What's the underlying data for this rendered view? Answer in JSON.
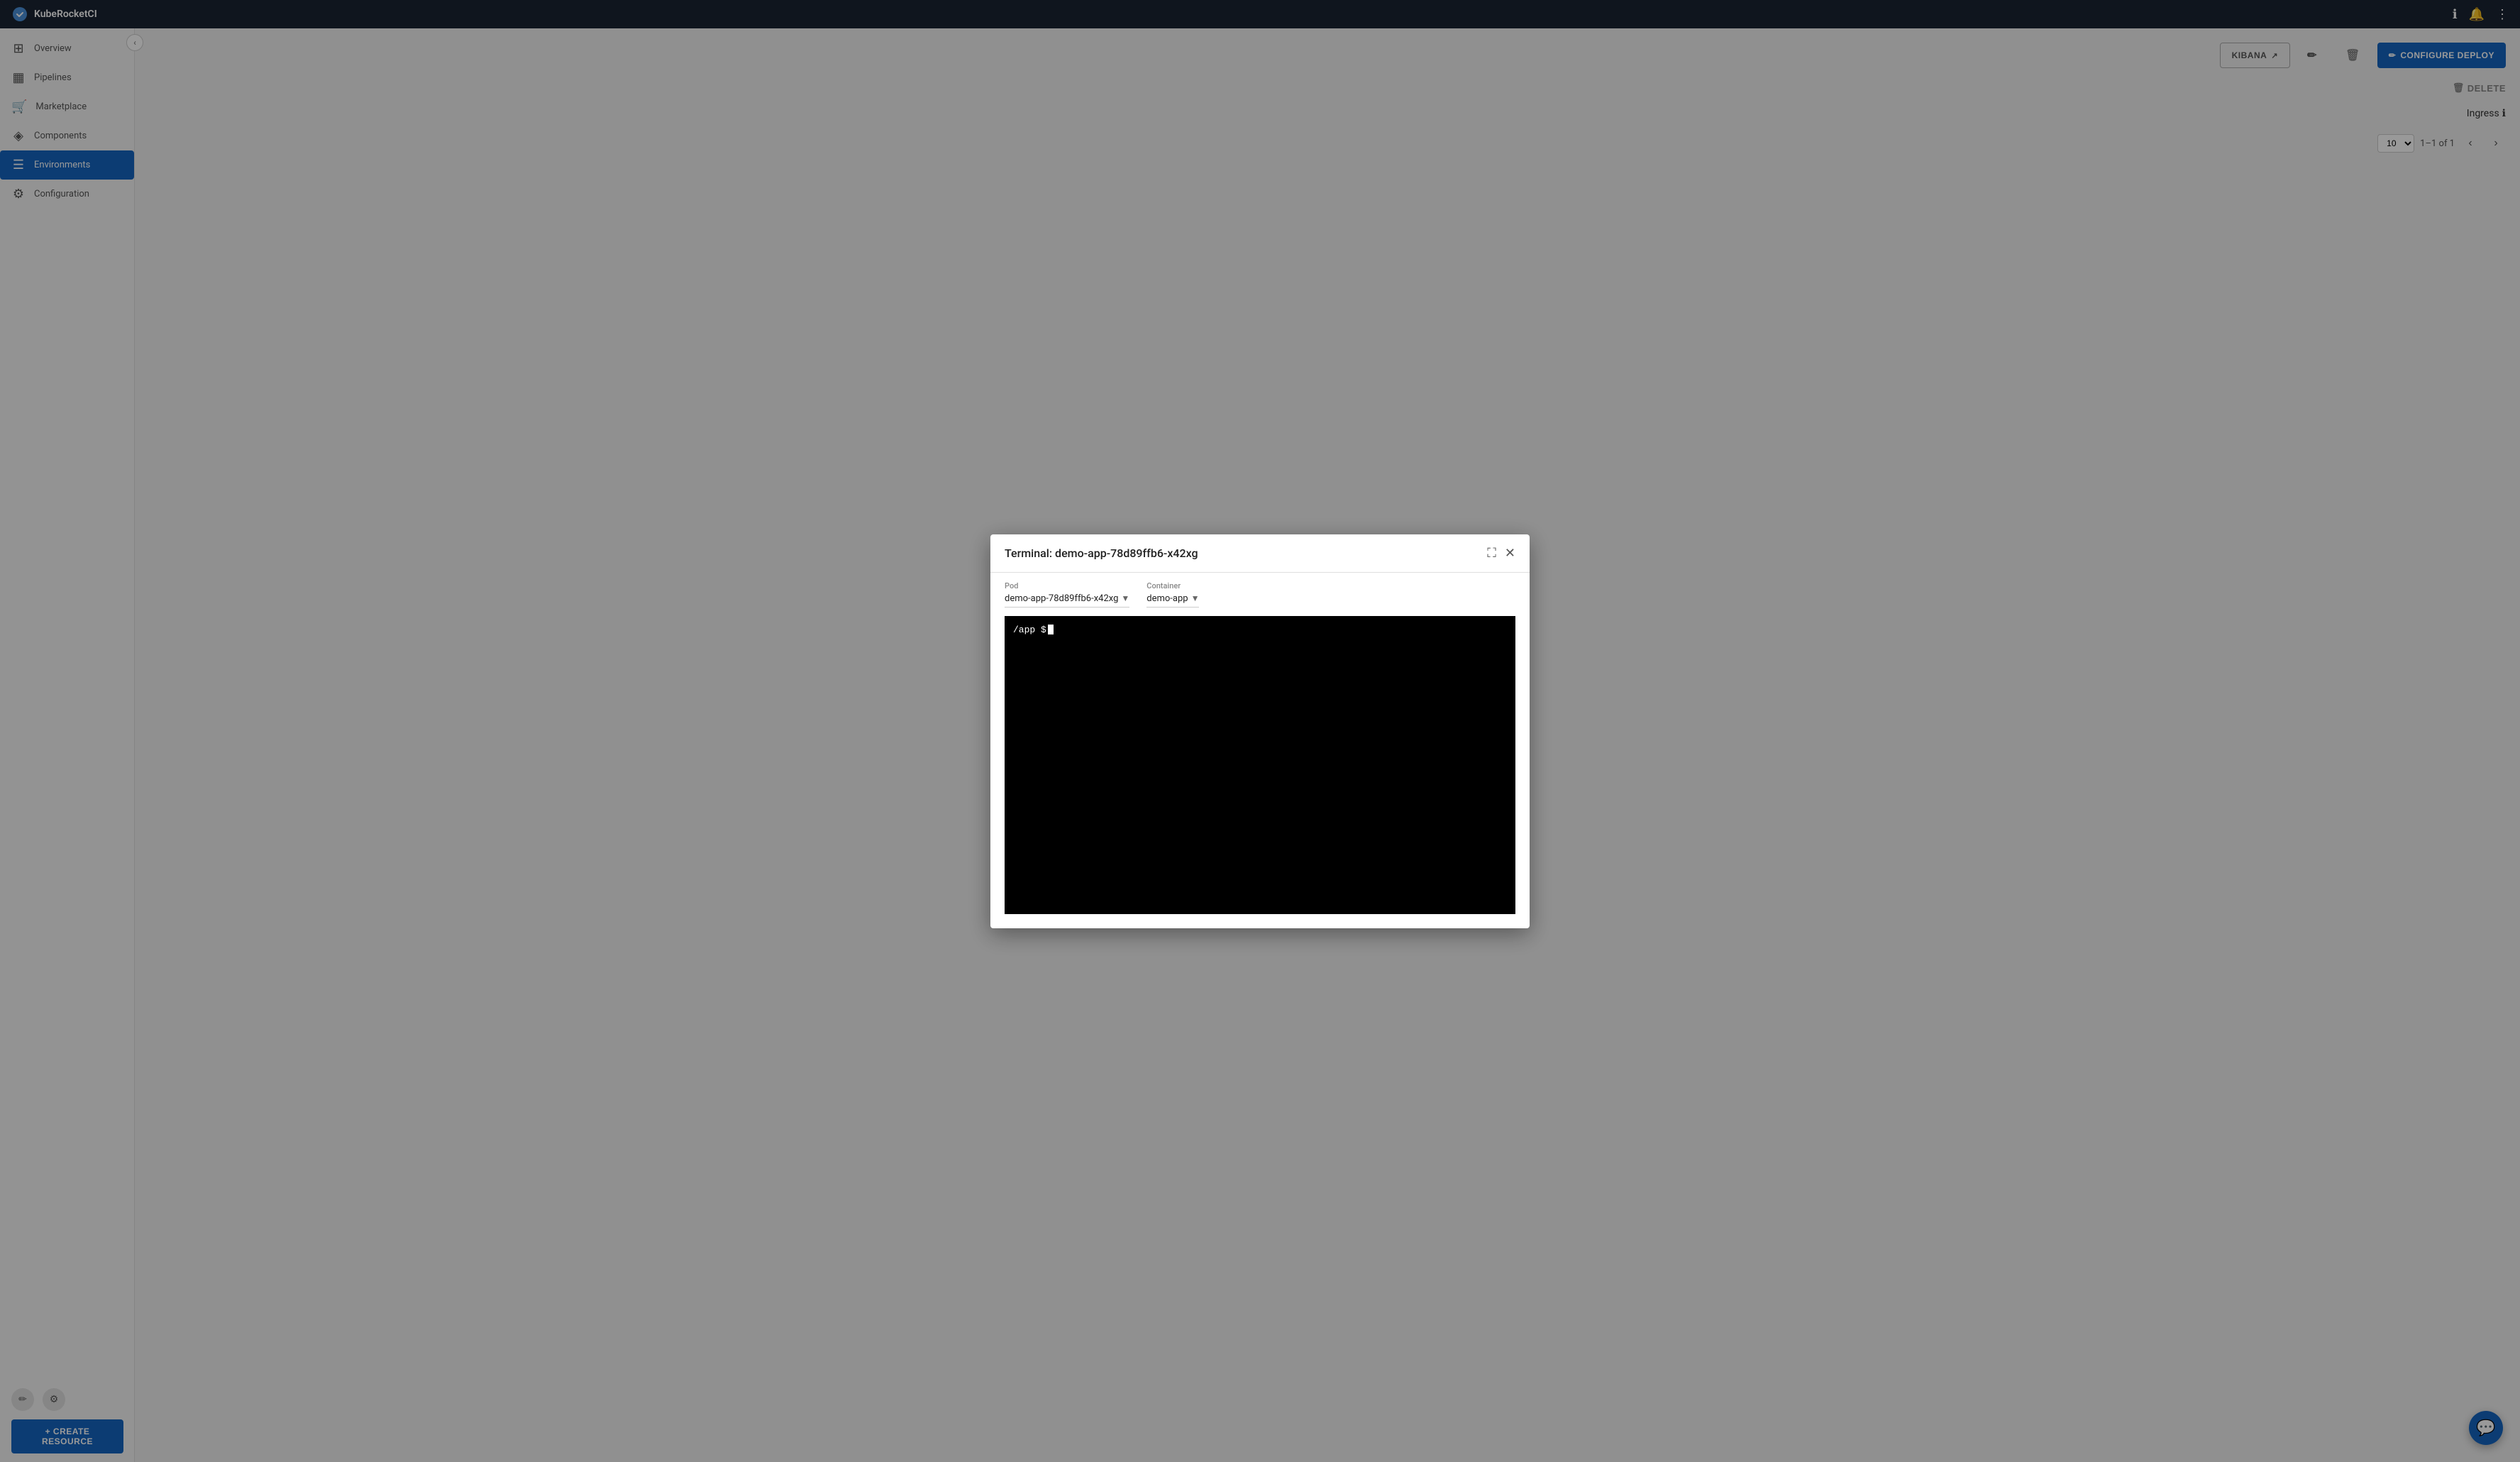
{
  "app": {
    "name": "KubeRocketCI",
    "logo_text": "KubeRocketCI"
  },
  "topbar": {
    "info_icon": "ℹ",
    "notifications_icon": "🔔",
    "menu_icon": "⋮"
  },
  "sidebar": {
    "collapse_icon": "‹",
    "items": [
      {
        "id": "overview",
        "label": "Overview",
        "icon": "⊞"
      },
      {
        "id": "pipelines",
        "label": "Pipelines",
        "icon": "▦"
      },
      {
        "id": "marketplace",
        "label": "Marketplace",
        "icon": "🛒"
      },
      {
        "id": "components",
        "label": "Components",
        "icon": "◈"
      },
      {
        "id": "environments",
        "label": "Environments",
        "icon": "☰",
        "active": true
      },
      {
        "id": "configuration",
        "label": "Configuration",
        "icon": "⚙"
      }
    ],
    "bottom_icons": [
      {
        "id": "pencil",
        "icon": "✏"
      },
      {
        "id": "settings",
        "icon": "⚙"
      }
    ],
    "create_resource_label": "+ CREATE RESOURCE"
  },
  "bg_content": {
    "kibana_label": "KIBANA",
    "configure_deploy_label": "CONFIGURE DEPLOY",
    "delete_label": "DELETE",
    "ingress_label": "Ingress",
    "pagination": {
      "range_text": "1–1 of 1",
      "prev_icon": "‹",
      "next_icon": "›"
    }
  },
  "modal": {
    "title": "Terminal: demo-app-78d89ffb6-x42xg",
    "expand_icon": "⛶",
    "close_icon": "✕",
    "pod_label": "Pod",
    "pod_value": "demo-app-78d89ffb6-x42xg",
    "container_label": "Container",
    "container_value": "demo-app",
    "terminal_prompt": "/app $"
  },
  "chat_fab": {
    "icon": "💬"
  }
}
